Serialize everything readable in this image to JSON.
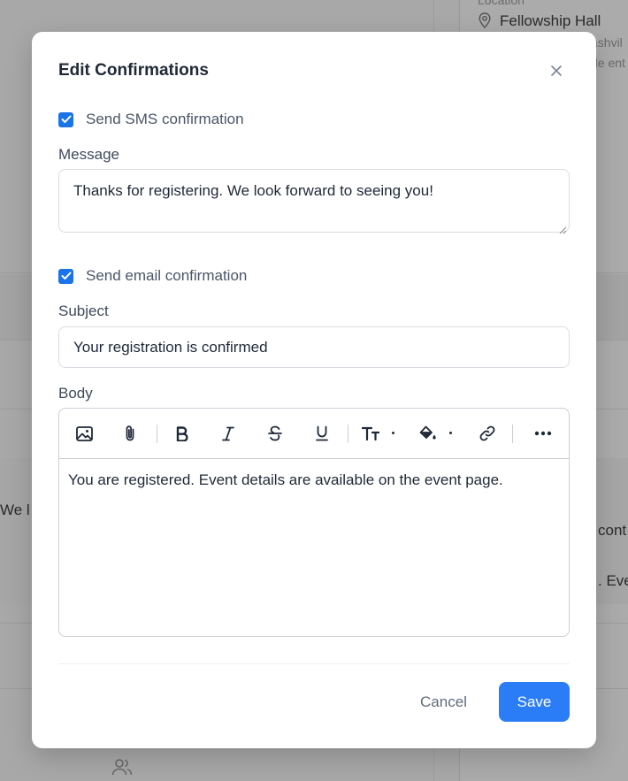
{
  "background": {
    "location_label": "Location",
    "location_value": "Fellowship Hall",
    "snippet_right_1": "ashvil",
    "snippet_right_2": "de ent",
    "snippet_left": "We l",
    "snippet_right_3": "cont",
    "snippet_right_4": ". Eve"
  },
  "modal": {
    "title": "Edit Confirmations",
    "sms": {
      "checkbox_label": "Send SMS confirmation",
      "checked": true,
      "message_label": "Message",
      "message_value": "Thanks for registering. We look forward to seeing you!"
    },
    "email": {
      "checkbox_label": "Send email confirmation",
      "checked": true,
      "subject_label": "Subject",
      "subject_value": "Your registration is confirmed",
      "body_label": "Body",
      "body_value": "You are registered. Event details are available on the event page."
    },
    "toolbar": {
      "icons": [
        "image-icon",
        "attachment-icon",
        "bold-icon",
        "italic-icon",
        "strikethrough-icon",
        "underline-icon",
        "text-size-icon",
        "fill-color-icon",
        "link-icon",
        "more-icon"
      ]
    },
    "buttons": {
      "cancel": "Cancel",
      "save": "Save"
    },
    "colors": {
      "accent": "#2b7cf7",
      "checkbox": "#1a73e8"
    }
  }
}
